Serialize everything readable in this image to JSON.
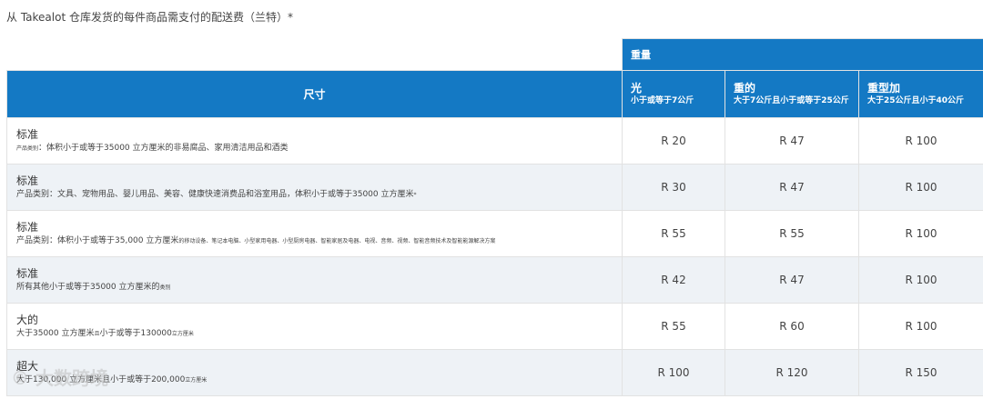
{
  "caption": "从 Takealot 仓库发货的每件商品需支付的配送费（兰特）*",
  "header": {
    "weight_group": "重量",
    "size_label": "尺寸",
    "columns": [
      {
        "title": "光",
        "sub": "小于或等于7公斤"
      },
      {
        "title": "重的",
        "sub": "大于7公斤且小于或等于25公斤"
      },
      {
        "title": "重型加",
        "sub": "大于25公斤且小于40公斤"
      }
    ]
  },
  "rows": [
    {
      "title": "标准",
      "sub_small": "产品类别",
      "sub": "：体积小于或等于35000 立方厘米的非易腐品、家用清洁用品和酒类",
      "sub_tail": "",
      "prices": [
        "R 20",
        "R 47",
        "R 100"
      ]
    },
    {
      "title": "标准",
      "sub_small": "",
      "sub": "产品类别：文具、宠物用品、婴儿用品、美容、健康快速消费品和浴室用品，体积小于或等于35000 立方厘米",
      "sub_tail": "*",
      "prices": [
        "R 30",
        "R 47",
        "R 100"
      ]
    },
    {
      "title": "标准",
      "sub_small": "",
      "sub": "产品类别：体积小于或等于35,000 立方厘米",
      "sub_tail": "的移动设备、笔记本电脑、小型家用电器、小型厨房电器、智能家居及电器、电视、音频、视频、智能音频技术及智能能源解决方案",
      "prices": [
        "R 55",
        "R 55",
        "R 100"
      ]
    },
    {
      "title": "标准",
      "sub_small": "",
      "sub": "所有其他小于或等于35000 立方厘米的",
      "sub_tail": "类别",
      "prices": [
        "R 42",
        "R 47",
        "R 100"
      ]
    },
    {
      "title": "大的",
      "sub_small": "",
      "sub": "大于35000 立方厘米",
      "sub_tail": "且",
      "sub2": "小于或等于130000",
      "sub2_tail": "立方厘米",
      "prices": [
        "R 55",
        "R 60",
        "R 100"
      ]
    },
    {
      "title": "超大",
      "sub_small": "",
      "sub": "大于130,000 立方厘米且小于或等于200,000",
      "sub_tail": "立方厘米",
      "prices": [
        "R 100",
        "R 120",
        "R 150"
      ]
    }
  ],
  "watermark": "© 大数跨境"
}
